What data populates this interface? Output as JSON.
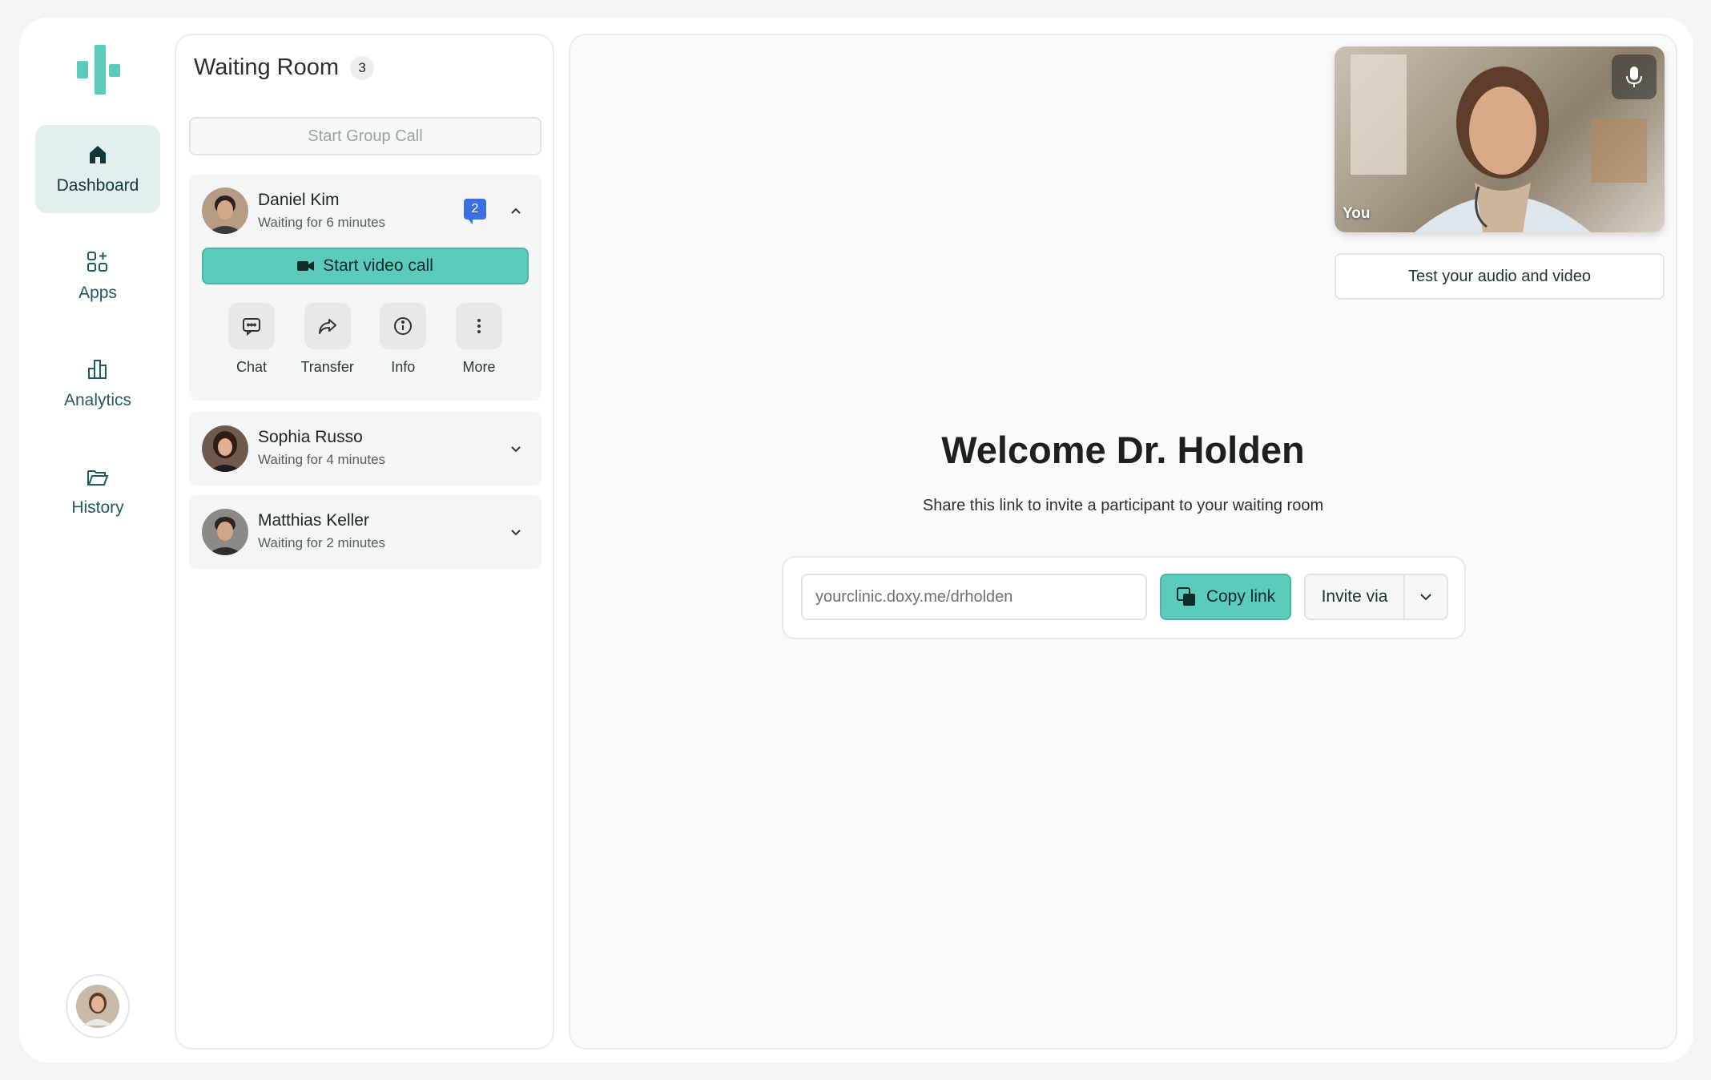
{
  "nav": {
    "items": [
      {
        "label": "Dashboard",
        "icon": "home-icon",
        "active": true
      },
      {
        "label": "Apps",
        "icon": "apps-icon",
        "active": false
      },
      {
        "label": "Analytics",
        "icon": "analytics-icon",
        "active": false
      },
      {
        "label": "History",
        "icon": "folder-icon",
        "active": false
      }
    ]
  },
  "waiting_room": {
    "title": "Waiting Room",
    "count": "3",
    "start_group_call": "Start Group Call",
    "patients": [
      {
        "name": "Daniel Kim",
        "status": "Waiting for 6 minutes",
        "unread": "2",
        "expanded": true
      },
      {
        "name": "Sophia Russo",
        "status": "Waiting for 4 minutes",
        "expanded": false
      },
      {
        "name": "Matthias Keller",
        "status": "Waiting for 2 minutes",
        "expanded": false
      }
    ],
    "start_video_call": "Start video call",
    "actions": [
      {
        "label": "Chat",
        "icon": "chat-icon"
      },
      {
        "label": "Transfer",
        "icon": "transfer-icon"
      },
      {
        "label": "Info",
        "icon": "info-icon"
      },
      {
        "label": "More",
        "icon": "more-icon"
      }
    ]
  },
  "main": {
    "self_view_label": "You",
    "test_av": "Test your audio and video",
    "welcome": "Welcome Dr. Holden",
    "share_text": "Share this link to invite a participant to your waiting room",
    "link_value": "yourclinic.doxy.me/drholden",
    "copy_link": "Copy link",
    "invite_via": "Invite via"
  },
  "colors": {
    "accent": "#5dcbbb",
    "nav_active_bg": "#e3eeee",
    "badge": "#3b6fe0"
  }
}
